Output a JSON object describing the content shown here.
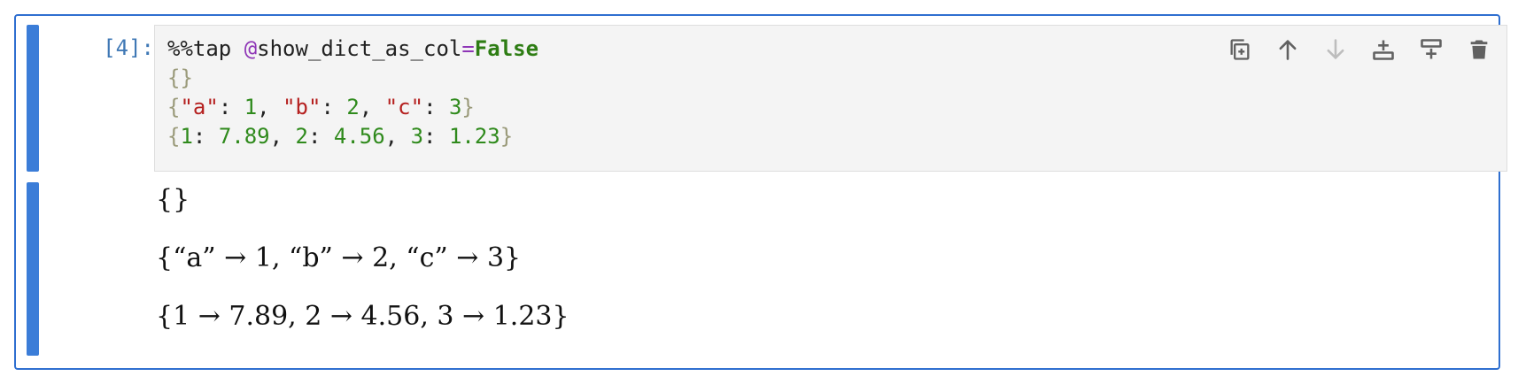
{
  "cell": {
    "prompt": "[4]:",
    "code_lines": [
      [
        {
          "t": "%%tap ",
          "c": "plain"
        },
        {
          "t": "@",
          "c": "kw"
        },
        {
          "t": "show_dict_as_col",
          "c": "plain"
        },
        {
          "t": "=",
          "c": "kw"
        },
        {
          "t": "False",
          "c": "bool"
        }
      ],
      [
        {
          "t": "{}",
          "c": "brace"
        }
      ],
      [
        {
          "t": "{",
          "c": "brace"
        },
        {
          "t": "\"a\"",
          "c": "str"
        },
        {
          "t": ": ",
          "c": "plain"
        },
        {
          "t": "1",
          "c": "num"
        },
        {
          "t": ", ",
          "c": "plain"
        },
        {
          "t": "\"b\"",
          "c": "str"
        },
        {
          "t": ": ",
          "c": "plain"
        },
        {
          "t": "2",
          "c": "num"
        },
        {
          "t": ", ",
          "c": "plain"
        },
        {
          "t": "\"c\"",
          "c": "str"
        },
        {
          "t": ": ",
          "c": "plain"
        },
        {
          "t": "3",
          "c": "num"
        },
        {
          "t": "}",
          "c": "brace"
        }
      ],
      [
        {
          "t": "{",
          "c": "brace"
        },
        {
          "t": "1",
          "c": "num"
        },
        {
          "t": ": ",
          "c": "plain"
        },
        {
          "t": "7.89",
          "c": "num"
        },
        {
          "t": ", ",
          "c": "plain"
        },
        {
          "t": "2",
          "c": "num"
        },
        {
          "t": ": ",
          "c": "plain"
        },
        {
          "t": "4.56",
          "c": "num"
        },
        {
          "t": ", ",
          "c": "plain"
        },
        {
          "t": "3",
          "c": "num"
        },
        {
          "t": ": ",
          "c": "plain"
        },
        {
          "t": "1.23",
          "c": "num"
        },
        {
          "t": "}",
          "c": "brace"
        }
      ]
    ]
  },
  "toolbar": {
    "buttons": [
      {
        "name": "duplicate-cell-button",
        "icon": "duplicate-icon",
        "enabled": true
      },
      {
        "name": "move-up-button",
        "icon": "arrow-up-icon",
        "enabled": true
      },
      {
        "name": "move-down-button",
        "icon": "arrow-down-icon",
        "enabled": false
      },
      {
        "name": "insert-above-button",
        "icon": "insert-above-icon",
        "enabled": true
      },
      {
        "name": "insert-below-button",
        "icon": "insert-below-icon",
        "enabled": true
      },
      {
        "name": "delete-cell-button",
        "icon": "trash-icon",
        "enabled": true
      }
    ]
  },
  "output": {
    "lines": [
      "{}",
      "{“a” → 1, “b” → 2, “c” → 3}",
      "{1 → 7.89, 2 → 4.56, 3 → 1.23}"
    ]
  },
  "colors": {
    "accent": "#2f6fd0",
    "collapser": "#3b7dd8",
    "prompt": "#3f78b5",
    "icon_enabled": "#616161",
    "icon_disabled": "#bdbdbd"
  }
}
